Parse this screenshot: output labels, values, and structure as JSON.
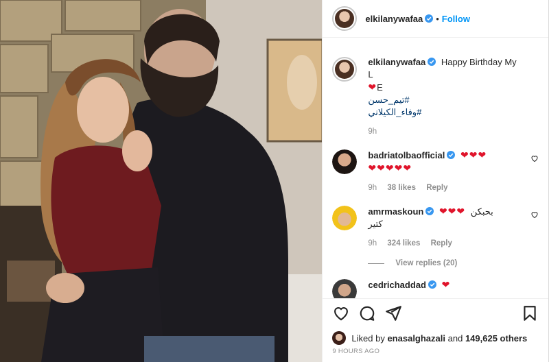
{
  "post": {
    "username": "elkilanywafaa",
    "follow_label": "Follow",
    "separator": "•",
    "caption_text": "Happy Birthday My L",
    "caption_cont": "E",
    "hashtags": [
      "#تيم_حسن",
      "#وفاء_الكيلاني"
    ],
    "caption_time": "9h"
  },
  "comments": [
    {
      "username": "badriatolbaofficial",
      "hearts_line1": "❤❤❤",
      "hearts_line2": "❤❤❤❤❤",
      "time": "9h",
      "likes": "38 likes",
      "reply": "Reply"
    },
    {
      "username": "amrmaskoun",
      "hearts_line1": "❤❤❤",
      "text_line1": "بحبكن",
      "text_line2": "كتير",
      "time": "9h",
      "likes": "324 likes",
      "reply": "Reply",
      "view_replies": "View replies (20)"
    },
    {
      "username": "cedrichaddad",
      "hearts_line1": "❤"
    }
  ],
  "likes": {
    "prefix": "Liked by",
    "user": "enasalghazali",
    "connector": "and",
    "count": "149,625 others"
  },
  "timestamp": "9 HOURS AGO",
  "icons": {
    "like": "heart-outline-icon",
    "comment": "comment-bubble-icon",
    "share": "paper-plane-icon",
    "save": "bookmark-icon",
    "verified": "verified-badge-icon"
  },
  "colors": {
    "link": "#0095f6",
    "hashtag": "#00376b",
    "heart": "#e0142b",
    "muted": "#8e8e8e"
  }
}
